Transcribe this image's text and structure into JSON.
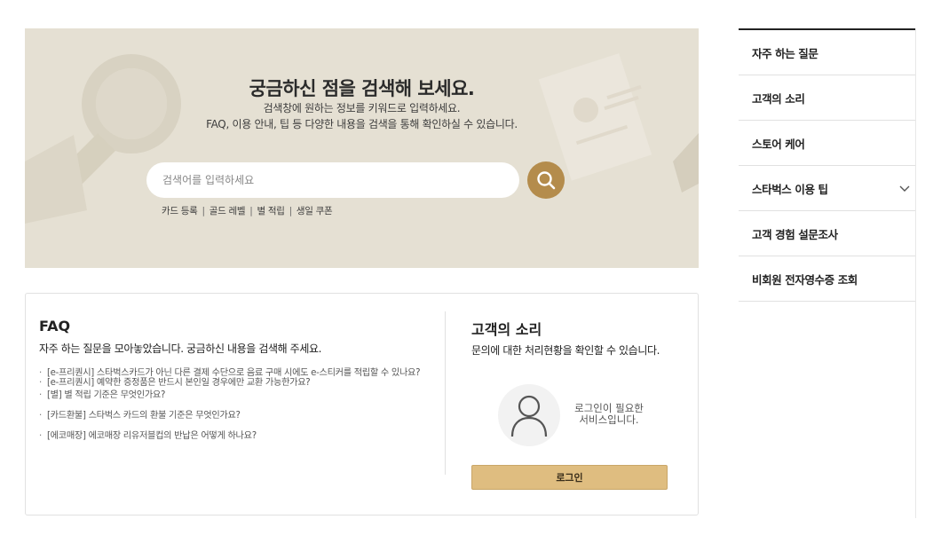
{
  "hero": {
    "title": "궁금하신 점을 검색해 보세요.",
    "subtitle_1": "검색창에 원하는 정보를 키워드로 입력하세요.",
    "subtitle_2": "FAQ, 이용 안내, 팁 등 다양한 내용을 검색을 통해 확인하실 수 있습니다.",
    "search_placeholder": "검색어를 입력하세요",
    "search_icon": "search-icon",
    "keywords": [
      "카드 등록",
      "골드 레벨",
      "별 적립",
      "생일 쿠폰"
    ],
    "separator": "|"
  },
  "faq": {
    "title": "FAQ",
    "description": "자주 하는 질문을 모아놓았습니다. 궁금하신 내용을 검색해 주세요.",
    "items": [
      "[e-프리퀀시] 스타벅스카드가 아닌 다른 결제 수단으로 음료 구매 시에도 e-스티커를 적립할 수 있나요?",
      "[e-프리퀀시] 예약한 증정품은 반드시 본인일 경우에만 교환 가능한가요?",
      "[별] 별 적립 기준은 무엇인가요?",
      "[카드환불] 스타벅스 카드의 환불 기준은 무엇인가요?",
      "[에코매장] 에코매장 리유저블컵의 반납은 어떻게 하나요?"
    ]
  },
  "voc": {
    "title": "고객의 소리",
    "description": "문의에 대한 처리현황을 확인할 수 있습니다.",
    "avatar_icon": "user-icon",
    "login_msg_1": "로그인이 필요한",
    "login_msg_2": "서비스입니다.",
    "login_button": "로그인"
  },
  "side_menu": {
    "items": [
      {
        "label": "자주 하는 질문"
      },
      {
        "label": "고객의 소리"
      },
      {
        "label": "스토어 케어"
      },
      {
        "label": "스타벅스 이용 팁",
        "icon": "chevron-down-icon"
      },
      {
        "label": "고객 경험 설문조사"
      },
      {
        "label": "비회원 전자영수증 조회"
      }
    ]
  },
  "colors": {
    "banner_bg": "#e5e0d3",
    "accent_gold": "#b48c4c",
    "login_button_bg": "#dfbd80"
  }
}
